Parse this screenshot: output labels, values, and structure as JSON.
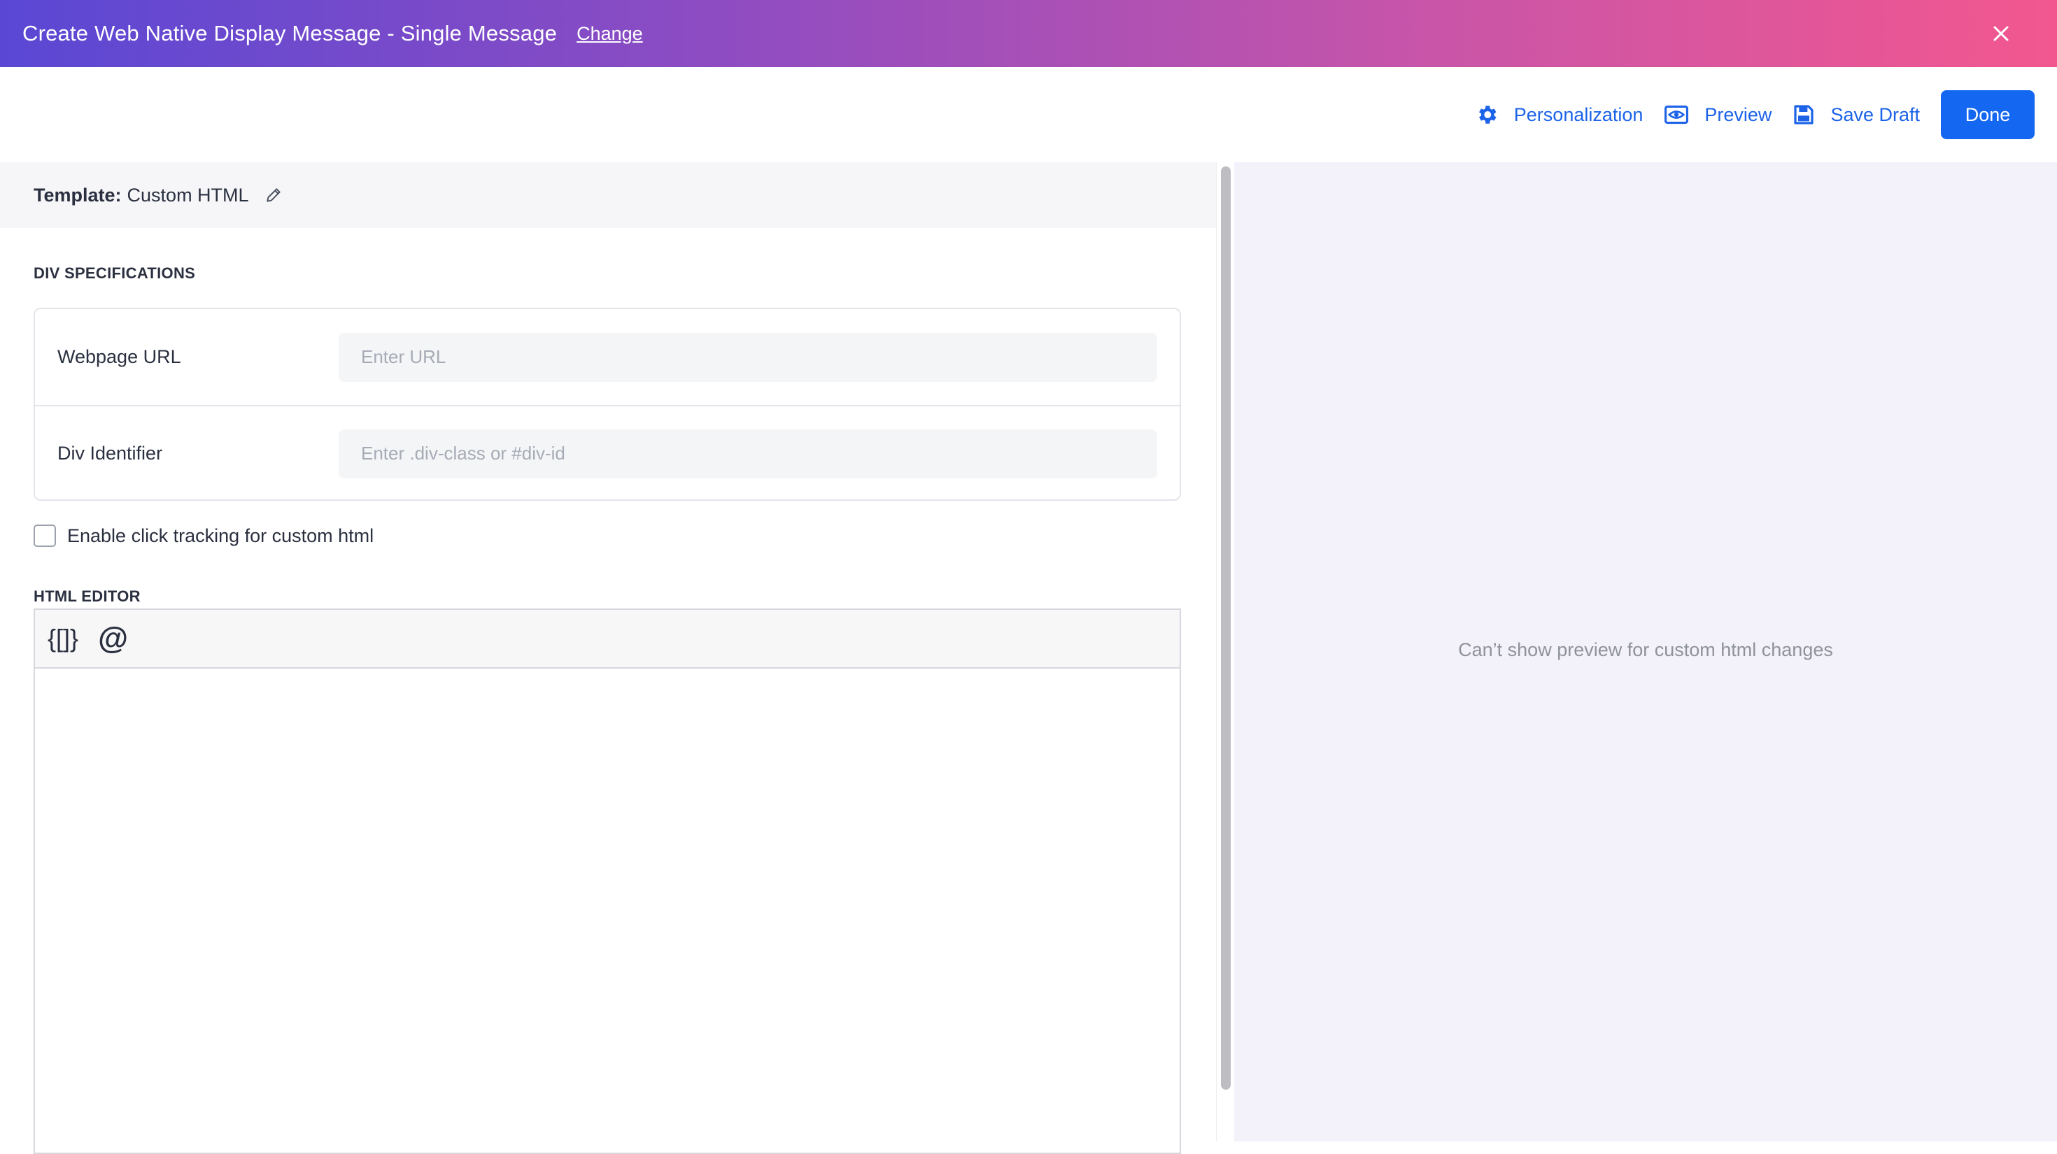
{
  "header": {
    "title": "Create Web Native Display Message - Single Message",
    "change_label": "Change"
  },
  "toolbar": {
    "personalization_label": "Personalization",
    "preview_label": "Preview",
    "save_draft_label": "Save Draft",
    "done_label": "Done",
    "accent_color": "#1467f0"
  },
  "template": {
    "label": "Template:",
    "value": "Custom HTML"
  },
  "div_specifications": {
    "heading": "DIV SPECIFICATIONS",
    "webpage_url": {
      "label": "Webpage URL",
      "placeholder": "Enter URL",
      "value": ""
    },
    "div_identifier": {
      "label": "Div Identifier",
      "placeholder": "Enter .div-class or #div-id",
      "value": ""
    }
  },
  "click_tracking": {
    "label": "Enable click tracking for custom html",
    "checked": false
  },
  "html_editor": {
    "heading": "HTML EDITOR",
    "merge_tag_button": "{[]}",
    "mention_button": "@",
    "content": ""
  },
  "preview_panel": {
    "message": "Can’t show preview for custom html changes"
  },
  "icons": {
    "close": "close-icon",
    "personalization": "gear-icon",
    "preview": "eye-icon",
    "save_draft": "floppy-disk-icon",
    "edit_template": "pencil-icon"
  }
}
